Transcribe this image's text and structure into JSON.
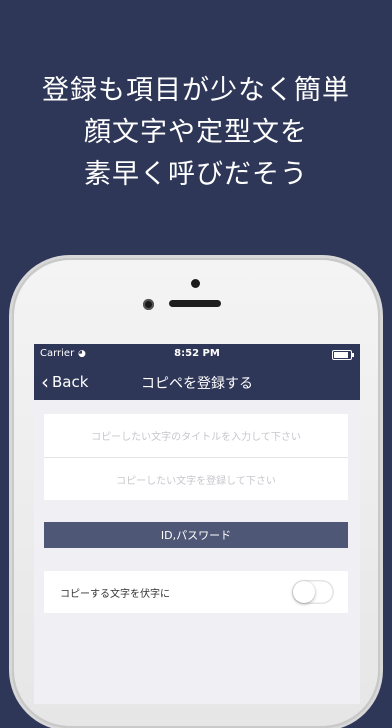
{
  "headline": {
    "lines": [
      "登録も項目が少なく簡単",
      "顔文字や定型文を",
      "素早く呼びだそう"
    ]
  },
  "status_bar": {
    "carrier": "Carrier",
    "time": "8:52 PM"
  },
  "navbar": {
    "back_label": "Back",
    "title": "コピペを登録する"
  },
  "form": {
    "title_placeholder": "コピーしたい文字のタイトルを入力して下さい",
    "text_placeholder": "コピーしたい文字を登録して下さい"
  },
  "section": {
    "header": "ID,パスワード"
  },
  "settings": {
    "mask_label": "コピーする文字を伏字に",
    "mask_enabled": false
  },
  "colors": {
    "background": "#2f3758",
    "navbar": "#2f3758",
    "section_header": "#4e5776"
  }
}
